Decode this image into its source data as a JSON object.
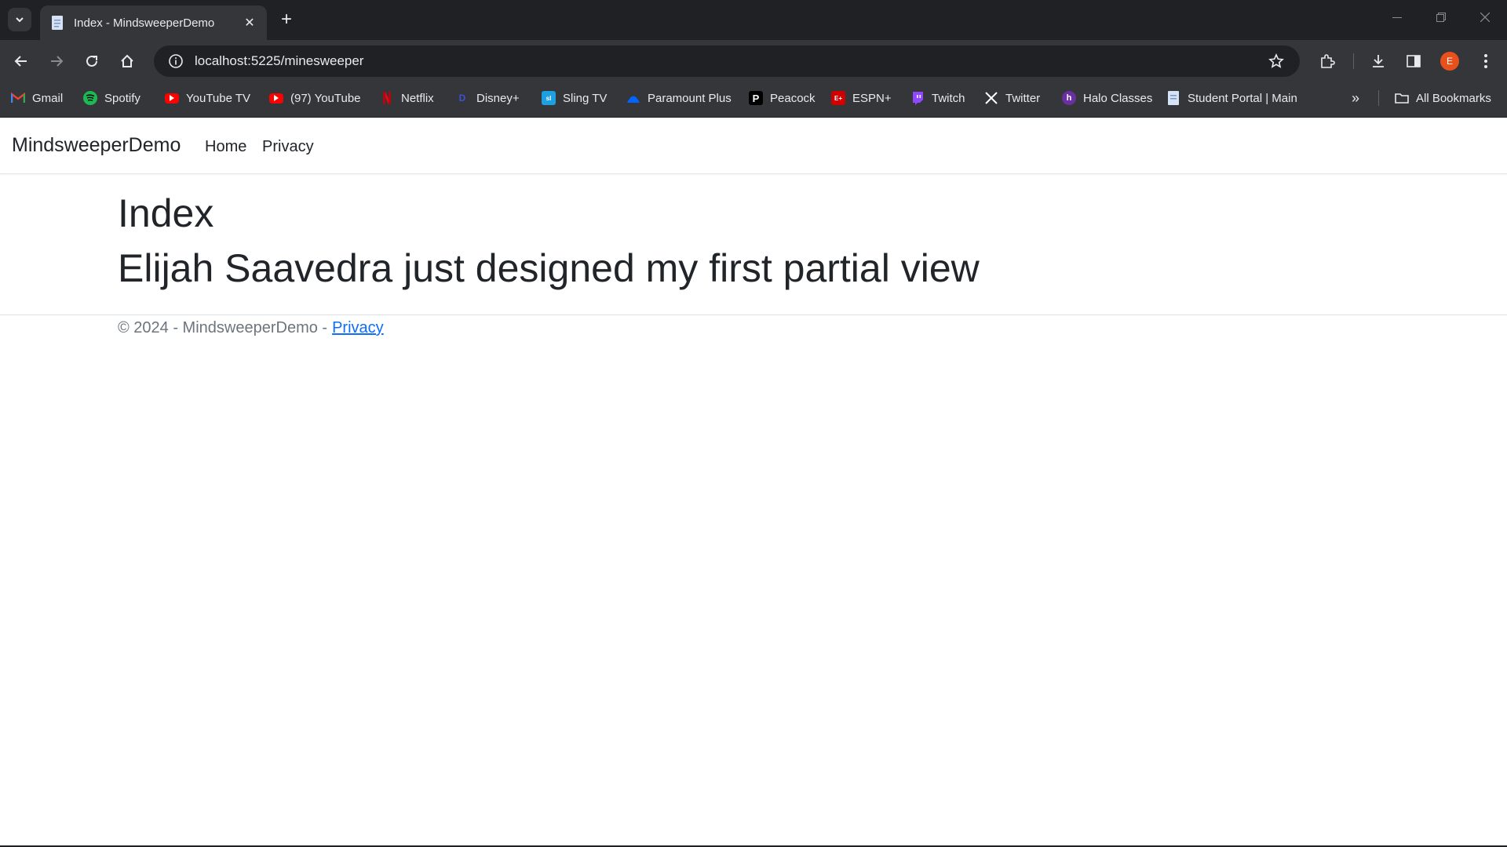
{
  "browser": {
    "tab_title": "Index - MindsweeperDemo",
    "url": "localhost:5225/minesweeper",
    "profile_initial": "E",
    "bookmarks": [
      {
        "label": "Gmail",
        "icon": "gmail-icon",
        "color": "#ea4335"
      },
      {
        "label": "Spotify",
        "icon": "spotify-icon",
        "color": "#1db954"
      },
      {
        "label": "YouTube TV",
        "icon": "youtube-tv-icon",
        "color": "#ff0000"
      },
      {
        "label": "(97) YouTube",
        "icon": "youtube-icon",
        "color": "#ff0000"
      },
      {
        "label": "Netflix",
        "icon": "netflix-icon",
        "color": "#e50914"
      },
      {
        "label": "Disney+",
        "icon": "disney-icon",
        "color": "#1a2cc6"
      },
      {
        "label": "Sling TV",
        "icon": "sling-icon",
        "color": "#1ea0e0"
      },
      {
        "label": "Paramount Plus",
        "icon": "paramount-icon",
        "color": "#0064ff"
      },
      {
        "label": "Peacock",
        "icon": "peacock-icon",
        "color": "#ffffff"
      },
      {
        "label": "ESPN+",
        "icon": "espn-icon",
        "color": "#d00000"
      },
      {
        "label": "Twitch",
        "icon": "twitch-icon",
        "color": "#9146ff"
      },
      {
        "label": "Twitter",
        "icon": "x-icon",
        "color": "#ffffff"
      },
      {
        "label": "Halo Classes",
        "icon": "halo-icon",
        "color": "#6a2fa0"
      },
      {
        "label": "Student Portal | Main",
        "icon": "document-icon",
        "color": "#cfd8e6"
      }
    ],
    "all_bookmarks": "All Bookmarks"
  },
  "page": {
    "brand": "MindsweeperDemo",
    "nav": {
      "home": "Home",
      "privacy": "Privacy"
    },
    "heading": "Index",
    "partial_heading": "Elijah Saavedra just designed my first partial view",
    "footer_text": "© 2024 - MindsweeperDemo -",
    "footer_link": "Privacy"
  }
}
